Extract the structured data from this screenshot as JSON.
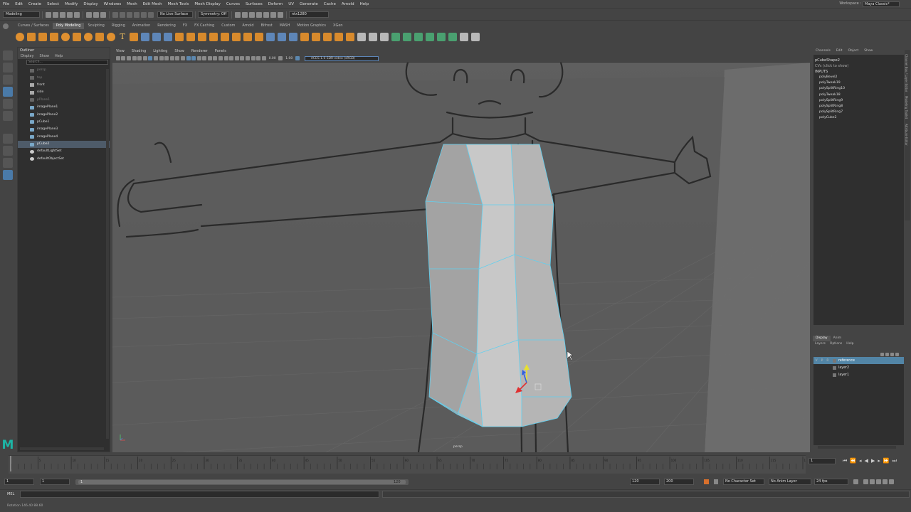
{
  "menubar": {
    "items": [
      "File",
      "Edit",
      "Create",
      "Select",
      "Modify",
      "Display",
      "Windows",
      "Mesh",
      "Edit Mesh",
      "Mesh Tools",
      "Mesh Display",
      "Curves",
      "Surfaces",
      "Deform",
      "UV",
      "Generate",
      "Cache",
      "Arnold",
      "Help"
    ],
    "workspace_label": "Workspace :",
    "workspace_value": "Maya Classic*"
  },
  "statusline": {
    "menuset": "Modeling",
    "live_surface": "No Live Surface",
    "symmetry": "Symmetry: Off",
    "renderer": "ntx1280"
  },
  "shelf_tabs": [
    "Curves / Surfaces",
    "Poly Modeling",
    "Sculpting",
    "Rigging",
    "Animation",
    "Rendering",
    "FX",
    "FX Caching",
    "Custom",
    "Arnold",
    "Bifrost",
    "MASH",
    "Motion Graphics",
    "XGen"
  ],
  "active_shelf_tab": "Poly Modeling",
  "outliner": {
    "title": "Outliner",
    "menu": [
      "Display",
      "Show",
      "Help"
    ],
    "search_placeholder": "Search...",
    "items": [
      {
        "label": "persp",
        "dim": true,
        "kind": "cam"
      },
      {
        "label": "top",
        "dim": true,
        "kind": "cam"
      },
      {
        "label": "front",
        "dim": false,
        "kind": "cam"
      },
      {
        "label": "side",
        "dim": false,
        "kind": "cam"
      },
      {
        "label": "pPlane1",
        "dim": true,
        "kind": "mesh"
      },
      {
        "label": "imagePlane1",
        "dim": false,
        "kind": "mesh"
      },
      {
        "label": "imagePlane2",
        "dim": false,
        "kind": "mesh"
      },
      {
        "label": "pCube1",
        "dim": false,
        "kind": "mesh"
      },
      {
        "label": "imagePlane3",
        "dim": false,
        "kind": "mesh"
      },
      {
        "label": "imagePlane4",
        "dim": false,
        "kind": "mesh"
      },
      {
        "label": "pCube2",
        "dim": false,
        "kind": "mesh",
        "selected": true
      },
      {
        "label": "defaultLightSet",
        "dim": false,
        "kind": "set"
      },
      {
        "label": "defaultObjectSet",
        "dim": false,
        "kind": "set"
      }
    ]
  },
  "viewport": {
    "menu": [
      "View",
      "Shading",
      "Lighting",
      "Show",
      "Renderer",
      "Panels"
    ],
    "near_value": "0.00",
    "far_value": "1.00",
    "colorspace": "ACES 1.0 SDR-video (sRGB)",
    "camera_label": "persp"
  },
  "channelbox": {
    "tabs": [
      "Channels",
      "Edit",
      "Object",
      "Show"
    ],
    "object_name": "pCubeShape2",
    "cvs_label": "CVs (click to show)",
    "inputs_header": "INPUTS",
    "inputs": [
      "polyBevel2",
      "polyTweak19",
      "polySplitRing10",
      "polyTweak18",
      "polySplitRing9",
      "polySplitRing8",
      "polySplitRing7",
      "polyCube2"
    ],
    "side_tabs": [
      "Channel Box / Layer Editor",
      "Modeling Toolkit",
      "Attribute Editor"
    ]
  },
  "layers": {
    "tabs": [
      "Display",
      "Anim"
    ],
    "active_tab": "Display",
    "menu": [
      "Layers",
      "Options",
      "Help"
    ],
    "rows": [
      {
        "vis": "V",
        "p": "P",
        "r": "R",
        "name": "reference",
        "selected": true
      },
      {
        "vis": "",
        "p": "",
        "r": "",
        "name": "layer2",
        "selected": false
      },
      {
        "vis": "",
        "p": "",
        "r": "",
        "name": "layer1",
        "selected": false
      }
    ]
  },
  "timeslider": {
    "current_frame": "1",
    "tick_labels": [
      "5",
      "10",
      "15",
      "20",
      "25",
      "30",
      "35",
      "40",
      "45",
      "50",
      "55",
      "60",
      "65",
      "70",
      "75",
      "80",
      "85",
      "90",
      "95",
      "100",
      "105",
      "110",
      "115",
      "120"
    ],
    "max_frame": 120
  },
  "range": {
    "start": "1",
    "playback_start": "1",
    "range_start": "1",
    "range_end": "120",
    "playback_end": "120",
    "end": "200",
    "character_set": "No Character Set",
    "anim_layer": "No Anim Layer",
    "fps": "24 fps"
  },
  "cmd": {
    "language": "MEL"
  },
  "helpline": "Rotation   146.40    88.60"
}
